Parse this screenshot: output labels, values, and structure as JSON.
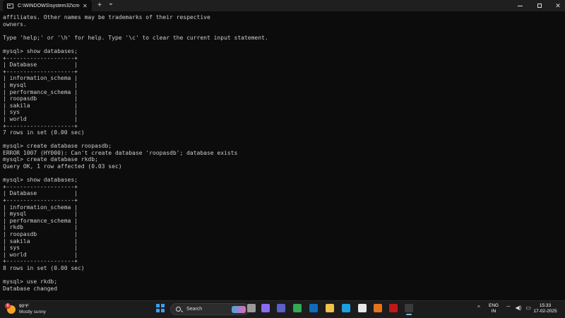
{
  "window": {
    "tab_title": "C:\\WINDOWS\\system32\\cmd.",
    "tab_close": "✕",
    "new_tab": "+",
    "dropdown": "⌄"
  },
  "terminal": {
    "lines": [
      "affiliates. Other names may be trademarks of their respective",
      "owners.",
      "",
      "Type 'help;' or '\\h' for help. Type '\\c' to clear the current input statement.",
      "",
      "mysql> show databases;",
      "+--------------------+",
      "| Database           |",
      "+--------------------+",
      "| information_schema |",
      "| mysql              |",
      "| performance_schema |",
      "| roopasdb           |",
      "| sakila             |",
      "| sys                |",
      "| world              |",
      "+--------------------+",
      "7 rows in set (0.00 sec)",
      "",
      "mysql> create database roopasdb;",
      "ERROR 1007 (HY000): Can't create database 'roopasdb'; database exists",
      "mysql> create database rkdb;",
      "Query OK, 1 row affected (0.03 sec)",
      "",
      "mysql> show databases;",
      "+--------------------+",
      "| Database           |",
      "+--------------------+",
      "| information_schema |",
      "| mysql              |",
      "| performance_schema |",
      "| rkdb               |",
      "| roopasdb           |",
      "| sakila             |",
      "| sys                |",
      "| world              |",
      "+--------------------+",
      "8 rows in set (0.00 sec)",
      "",
      "mysql> use rkdb;",
      "Database changed"
    ]
  },
  "taskbar": {
    "weather_badge": "6",
    "weather_temp": "90°F",
    "weather_condition": "Mostly sunny",
    "search_label": "Search",
    "apps": [
      {
        "name": "task-view-icon",
        "color": "#9a9a9a"
      },
      {
        "name": "copilot-icon",
        "color": "#8a6cf0"
      },
      {
        "name": "teams-icon",
        "color": "#5b5fc7"
      },
      {
        "name": "chrome-icon",
        "color": "#34a853"
      },
      {
        "name": "mail-icon",
        "color": "#0f6cbd"
      },
      {
        "name": "file-explorer-icon",
        "color": "#f0c14b"
      },
      {
        "name": "edge-icon",
        "color": "#1ba1e2"
      },
      {
        "name": "store-icon",
        "color": "#e8e8e8"
      },
      {
        "name": "office-icon",
        "color": "#e3731c"
      },
      {
        "name": "mcafee-icon",
        "color": "#c01818"
      },
      {
        "name": "terminal-icon",
        "color": "#3a3a3a"
      }
    ],
    "tray_chevron": "^",
    "lang_primary": "ENG",
    "lang_secondary": "IN",
    "wifi": "⌔",
    "volume": "◀)",
    "battery": "▭",
    "time": "15:33",
    "date": "17-02-2025"
  }
}
